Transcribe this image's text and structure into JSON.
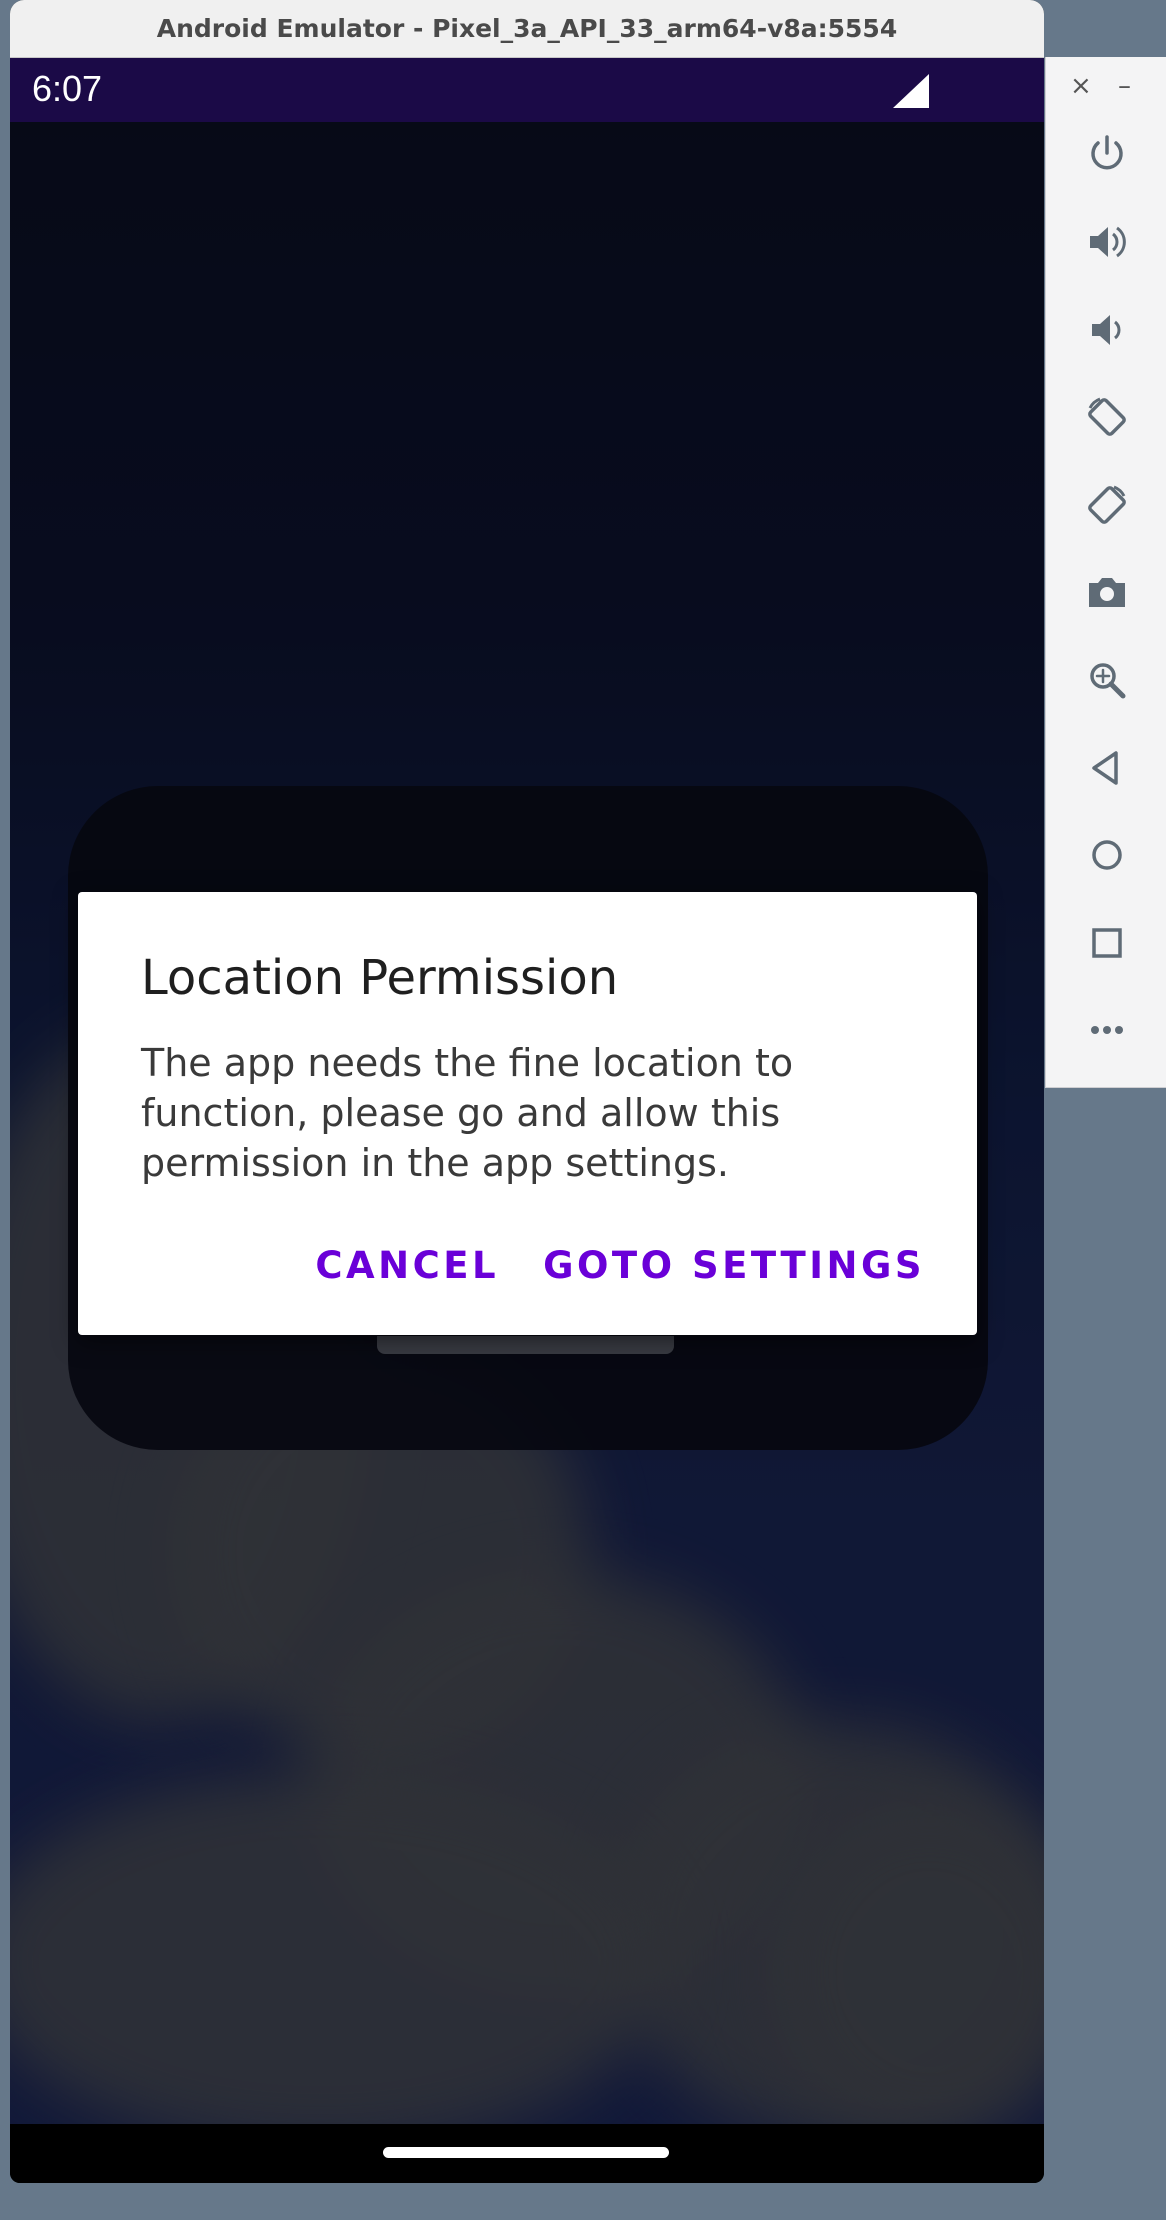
{
  "window": {
    "title": "Android Emulator - Pixel_3a_API_33_arm64-v8a:5554"
  },
  "statusbar": {
    "time": "6:07"
  },
  "dialog": {
    "title": "Location Permission",
    "message": "The app needs the fine location to function, please go and allow this permission in the app settings.",
    "cancel_label": "CANCEL",
    "settings_label": "GOTO SETTINGS",
    "accent": "#6a00d8"
  },
  "toolbar": {
    "close_label": "×",
    "minimize_label": "–",
    "buttons": [
      "power-icon",
      "volume-up-icon",
      "volume-down-icon",
      "rotate-left-icon",
      "rotate-right-icon",
      "camera-icon",
      "zoom-icon",
      "back-icon",
      "home-icon",
      "overview-icon",
      "more-icon"
    ]
  }
}
